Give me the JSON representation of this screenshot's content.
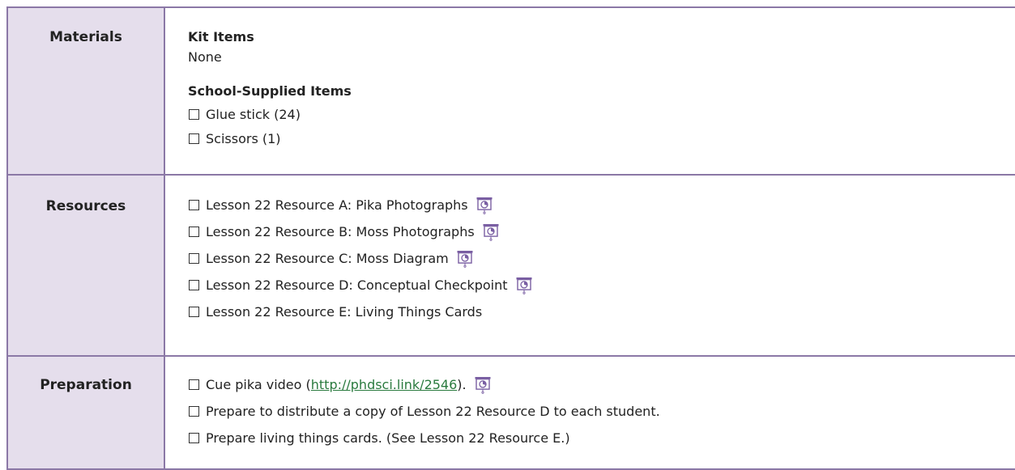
{
  "materials": {
    "label": "Materials",
    "kit_heading": "Kit Items",
    "kit_value": "None",
    "school_heading": "School-Supplied Items",
    "school_items": [
      "Glue stick (24)",
      "Scissors (1)"
    ]
  },
  "resources": {
    "label": "Resources",
    "items": [
      "Lesson 22 Resource A: Pika Photographs",
      "Lesson 22 Resource B: Moss Photographs",
      "Lesson 22 Resource C: Moss Diagram",
      "Lesson 22 Resource D: Conceptual Checkpoint",
      "Lesson 22 Resource E: Living Things Cards"
    ]
  },
  "preparation": {
    "label": "Preparation",
    "item1_prefix": "Cue pika video (",
    "item1_link": "http://phdsci.link/2546",
    "item1_suffix": ").",
    "item2": "Prepare to distribute a copy of Lesson 22 Resource D to each student.",
    "item3": "Prepare living things cards. (See Lesson 22 Resource E.)"
  },
  "icons": {
    "projection": "projection-screen-icon",
    "checkbox": "checkbox-icon"
  },
  "colors": {
    "header_bg": "#e5deec",
    "border": "#8b78a6",
    "link": "#2a7a3e",
    "icon": "#7a5fa3"
  }
}
